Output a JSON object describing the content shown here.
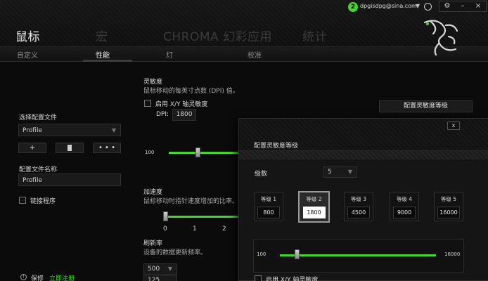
{
  "header": {
    "tabs": [
      {
        "label": "鼠标",
        "active": true
      },
      {
        "label": "宏",
        "active": false
      },
      {
        "label": "CHROMA 幻彩应用",
        "active": false
      },
      {
        "label": "统计",
        "active": false
      }
    ],
    "subtabs": [
      {
        "label": "自定义",
        "active": false
      },
      {
        "label": "性能",
        "active": true
      },
      {
        "label": "灯",
        "active": false
      },
      {
        "label": "校准",
        "active": false
      }
    ],
    "user_email": "dpgisdpg@sina.com",
    "window_buttons": [
      "⚙",
      "–",
      "×"
    ]
  },
  "left": {
    "profile_section_label": "选择配置文件",
    "profile_selected": "Profile",
    "profile_buttons": [
      "+",
      "",
      "• • •"
    ],
    "profile_name_label": "配置文件名称",
    "profile_name_value": "Profile",
    "link_program_label": "链接程序",
    "link_program_checked": false,
    "footer_info": "保修",
    "footer_link": "立即注册"
  },
  "sensitivity": {
    "title": "灵敏度",
    "description": "鼠标移动的每英寸点数 (DPI) 值。",
    "xy_label": "启用 X/Y 轴灵敏度",
    "xy_checked": false,
    "dpi_label": "DPI:",
    "dpi_value": "1800",
    "stages_button": "配置灵敏度等级",
    "slider_min": "100"
  },
  "acceleration": {
    "title": "加速度",
    "description": "鼠标移动时指针速度增加的比率。",
    "ticks": [
      "0",
      "1",
      "2"
    ]
  },
  "polling": {
    "title": "刷新率",
    "description": "设备的数据更新频率。",
    "value": "500",
    "value2": "125"
  },
  "dialog": {
    "title": "配置灵敏度等级",
    "close": "x",
    "levels_label": "级数",
    "levels_value": "5",
    "stages": [
      {
        "title": "等级 1",
        "value": "800",
        "active": false
      },
      {
        "title": "等级 2",
        "value": "1800",
        "active": true
      },
      {
        "title": "等级 3",
        "value": "4500",
        "active": false
      },
      {
        "title": "等级 4",
        "value": "9000",
        "active": false
      },
      {
        "title": "等级 5",
        "value": "16000",
        "active": false
      }
    ],
    "slider_min": "100",
    "slider_max": "16000",
    "xy_label": "启用 X/Y 轴灵敏度"
  },
  "colors": {
    "accent": "#44d62c"
  }
}
